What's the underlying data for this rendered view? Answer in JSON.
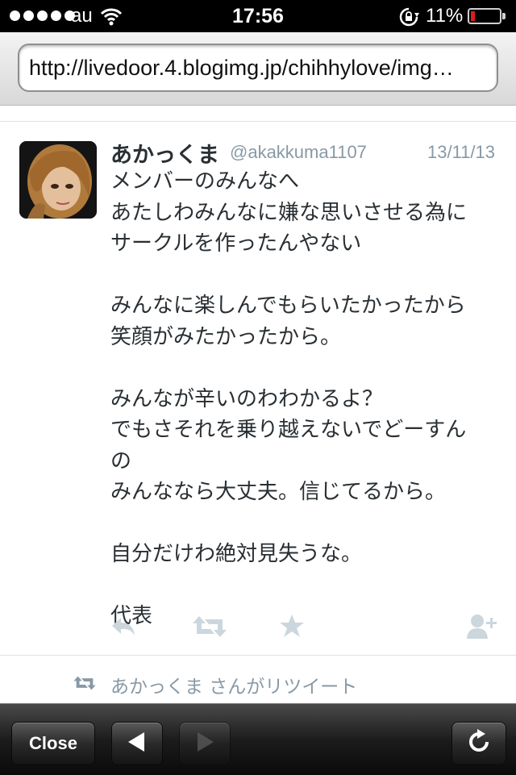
{
  "status": {
    "carrier": "au",
    "time": "17:56",
    "battery": "11%"
  },
  "browser": {
    "url": "http://livedoor.4.blogimg.jp/chihhylove/img…",
    "close_label": "Close"
  },
  "tweet": {
    "author": "あかっくま",
    "handle": "@akakkuma1107",
    "date": "13/11/13",
    "lines": [
      "メンバーのみんなへ",
      "あたしわみんなに嫌な思いさせる為に",
      "サークルを作ったんやない",
      "",
      "みんなに楽しんでもらいたかったから",
      "笑顔がみたかったから。",
      "",
      "みんなが辛いのわわかるよ？",
      "でもさそれを乗り越えないでどーすん",
      "の",
      "みんななら大丈夫。信じてるから。",
      "",
      "自分だけわ絶対見失うな。",
      "",
      "代表"
    ],
    "retweeted_by": "あかっくま さんがリツイート"
  },
  "icons": [
    "reply-icon",
    "retweet-icon",
    "favorite-icon",
    "follow-icon",
    "back-arrow-icon",
    "forward-arrow-icon",
    "reload-icon"
  ],
  "colors": {
    "accent_gray": "#8899a6",
    "text": "#292f33",
    "battery_low": "#e01b1b"
  }
}
